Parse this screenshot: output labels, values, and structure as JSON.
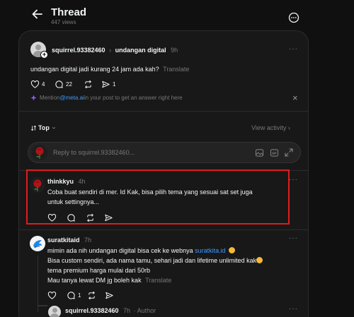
{
  "header": {
    "title": "Thread",
    "views": "447 views"
  },
  "original_post": {
    "username": "squirrel.93382460",
    "separator": "›",
    "topic": "undangan digital",
    "time": "9h",
    "text": "undangan digital jadi kurang 24 jam ada kah?",
    "translate": "Translate",
    "likes": "4",
    "comments": "22",
    "reposts": "",
    "shares": "1",
    "meta_hint_prefix": "Mention ",
    "meta_hint_link": "@meta.ai",
    "meta_hint_suffix": " in your post to get an answer right here",
    "close": "×",
    "more": "···"
  },
  "sort": {
    "label": "Top",
    "view_activity": "View activity ›"
  },
  "reply_box": {
    "placeholder": "Reply to squirrel.93382460..."
  },
  "replies": [
    {
      "username": "thinkkyu",
      "time": "4h",
      "line1": "Coba buat sendiri di mer. Id Kak, bisa pilih tema yang sesuai sat set juga",
      "line2": "untuk settingnya...",
      "more": "···"
    },
    {
      "username": "suratkitaid",
      "time": "7h",
      "line1_prefix": "mimin ada nih undangan digital bisa cek ke webnya ",
      "line1_link": "suratkita.id",
      "line2": "Bisa custom sendiri, ada nama tamu, sehari jadi dan lifetime unlimited kak",
      "line3": "tema premium harga mulai dari 50rb",
      "line4": "Mau tanya lewat DM jg boleh kak",
      "translate": "Translate",
      "comments": "1",
      "more": "···"
    },
    {
      "username": "squirrel.93382460",
      "time": "7h",
      "badge": "· Author",
      "more": "···"
    }
  ],
  "colors": {
    "background": "#101010",
    "card": "#181818",
    "highlight_border": "#e11b1b",
    "link": "#3b9cff",
    "meta_ai": "#8b5cf6"
  }
}
